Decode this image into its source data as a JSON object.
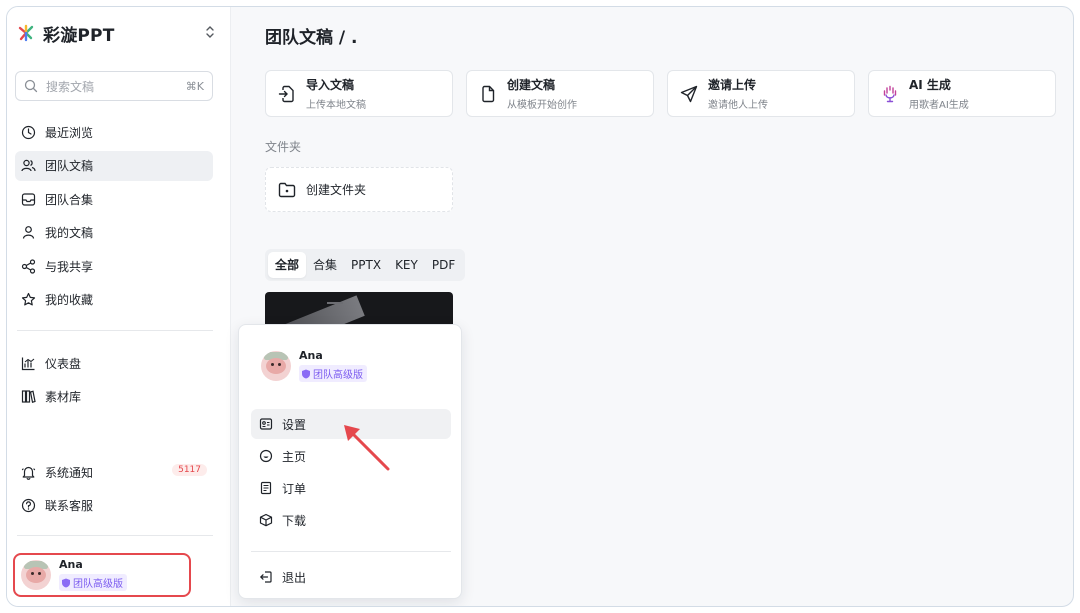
{
  "brand": {
    "name": "彩漩PPT"
  },
  "search": {
    "placeholder": "搜索文稿",
    "shortcut": "⌘K"
  },
  "sidebar": {
    "items": [
      {
        "label": "最近浏览",
        "icon": "clock-icon"
      },
      {
        "label": "团队文稿",
        "icon": "team-icon",
        "active": true
      },
      {
        "label": "团队合集",
        "icon": "collection-icon"
      },
      {
        "label": "我的文稿",
        "icon": "user-icon"
      },
      {
        "label": "与我共享",
        "icon": "share-icon"
      },
      {
        "label": "我的收藏",
        "icon": "star-icon"
      }
    ],
    "tools": [
      {
        "label": "仪表盘",
        "icon": "dashboard-icon"
      },
      {
        "label": "素材库",
        "icon": "library-icon"
      }
    ],
    "footer": [
      {
        "label": "系统通知",
        "icon": "bell-icon",
        "badge": "5117"
      },
      {
        "label": "联系客服",
        "icon": "help-icon"
      }
    ]
  },
  "user": {
    "name": "Ana",
    "plan": "团队高级版"
  },
  "main": {
    "title": "团队文稿 / .",
    "actions": [
      {
        "title": "导入文稿",
        "subtitle": "上传本地文稿",
        "icon": "import-icon"
      },
      {
        "title": "创建文稿",
        "subtitle": "从模板开始创作",
        "icon": "file-icon"
      },
      {
        "title": "邀请上传",
        "subtitle": "邀请他人上传",
        "icon": "send-icon"
      },
      {
        "title": "AI 生成",
        "subtitle": "用歌者AI生成",
        "icon": "ai-icon"
      }
    ],
    "folder_section": "文件夹",
    "create_folder": "创建文件夹",
    "filters": [
      "全部",
      "合集",
      "PPTX",
      "KEY",
      "PDF"
    ],
    "active_filter": "全部"
  },
  "menu": {
    "items": [
      {
        "label": "设置",
        "icon": "settings-icon"
      },
      {
        "label": "主页",
        "icon": "home-icon"
      },
      {
        "label": "订单",
        "icon": "order-icon"
      },
      {
        "label": "下载",
        "icon": "download-icon"
      }
    ],
    "logout": {
      "label": "退出",
      "icon": "logout-icon"
    }
  },
  "colors": {
    "accent_red": "#e5484d",
    "plan_purple": "#7c5cf0",
    "sidebar_active": "#eef0f3"
  }
}
